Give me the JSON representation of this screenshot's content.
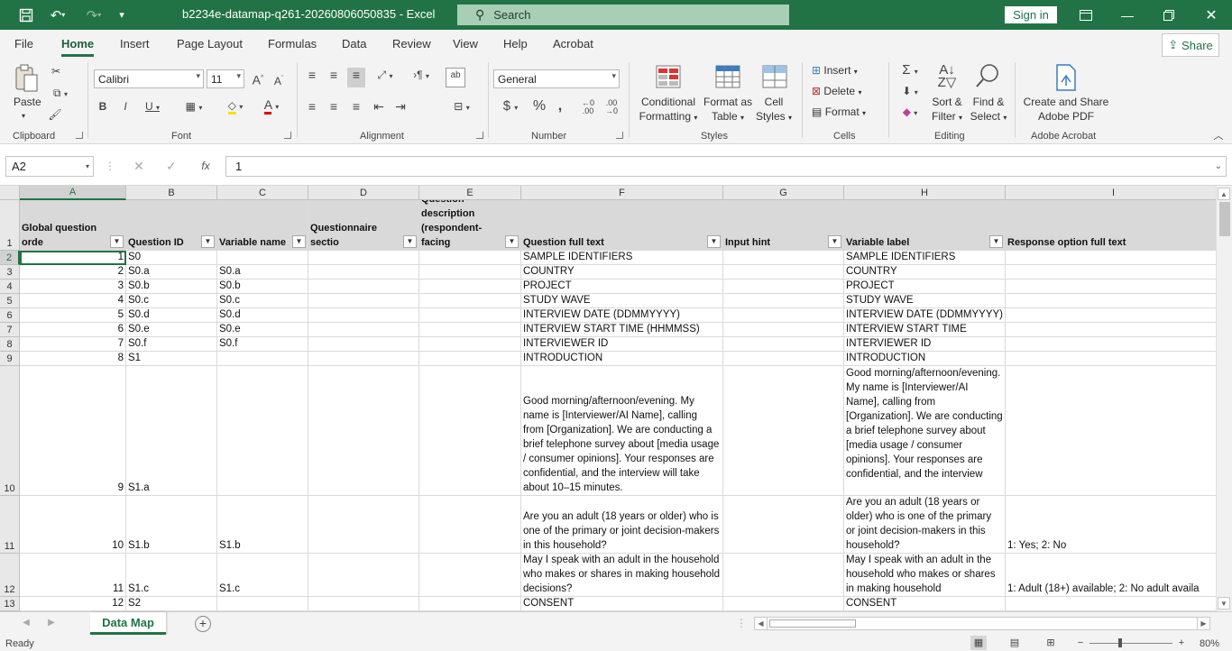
{
  "window": {
    "doc_title": "b2234e-datamap-q261-20260806050835  -  Excel",
    "search_placeholder": "Search",
    "sign_in": "Sign in"
  },
  "tabs": [
    "File",
    "Home",
    "Insert",
    "Page Layout",
    "Formulas",
    "Data",
    "Review",
    "View",
    "Help",
    "Acrobat"
  ],
  "share": "Share",
  "ribbon": {
    "clipboard": {
      "paste": "Paste",
      "label": "Clipboard"
    },
    "font": {
      "name": "Calibri",
      "size": "11",
      "label": "Font"
    },
    "alignment": {
      "label": "Alignment"
    },
    "number": {
      "format": "General",
      "label": "Number"
    },
    "styles": {
      "cond1": "Conditional",
      "cond2": "Formatting",
      "fmt1": "Format as",
      "fmt2": "Table",
      "cell1": "Cell",
      "cell2": "Styles",
      "label": "Styles"
    },
    "cells": {
      "insert": "Insert",
      "delete": "Delete",
      "format": "Format",
      "label": "Cells"
    },
    "editing": {
      "sort1": "Sort &",
      "sort2": "Filter",
      "find1": "Find &",
      "find2": "Select",
      "label": "Editing"
    },
    "acrobat": {
      "create1": "Create and Share",
      "create2": "Adobe PDF",
      "label": "Adobe Acrobat"
    }
  },
  "formula_bar": {
    "name_box": "A2",
    "fx": "fx",
    "value": "1"
  },
  "columns": [
    "A",
    "B",
    "C",
    "D",
    "E",
    "F",
    "G",
    "H",
    "I"
  ],
  "header_row": {
    "row_num": "1",
    "A": "Global question orde",
    "B": "Question ID",
    "C": "Variable name",
    "D": "Questionnaire sectio",
    "E": "Question description (respondent-facing",
    "F": "Question full text",
    "G": "Input hint",
    "H": "Variable label",
    "I": "Response option full text"
  },
  "rows": [
    {
      "n": "2",
      "A": "1",
      "B": "S0",
      "C": "",
      "F": "SAMPLE IDENTIFIERS",
      "H": "SAMPLE IDENTIFIERS",
      "I": ""
    },
    {
      "n": "3",
      "A": "2",
      "B": "S0.a",
      "C": "S0.a",
      "F": "COUNTRY",
      "H": "COUNTRY",
      "I": ""
    },
    {
      "n": "4",
      "A": "3",
      "B": "S0.b",
      "C": "S0.b",
      "F": "PROJECT",
      "H": "PROJECT",
      "I": ""
    },
    {
      "n": "5",
      "A": "4",
      "B": "S0.c",
      "C": "S0.c",
      "F": "STUDY WAVE",
      "H": "STUDY WAVE",
      "I": ""
    },
    {
      "n": "6",
      "A": "5",
      "B": "S0.d",
      "C": "S0.d",
      "F": "INTERVIEW DATE (DDMMYYYY)",
      "H": "INTERVIEW DATE (DDMMYYYY)",
      "I": ""
    },
    {
      "n": "7",
      "A": "6",
      "B": "S0.e",
      "C": "S0.e",
      "F": "INTERVIEW START TIME (HHMMSS)",
      "H": "INTERVIEW START TIME",
      "I": ""
    },
    {
      "n": "8",
      "A": "7",
      "B": "S0.f",
      "C": "S0.f",
      "F": "INTERVIEWER ID",
      "H": "INTERVIEWER ID",
      "I": ""
    },
    {
      "n": "9",
      "A": "8",
      "B": "S1",
      "C": "",
      "F": "INTRODUCTION",
      "H": "INTRODUCTION",
      "I": ""
    },
    {
      "n": "10",
      "A": "9",
      "B": "S1.a",
      "C": "",
      "F": "Good morning/afternoon/evening. My name is [Interviewer/AI Name], calling from [Organization]. We are conducting a brief telephone survey about [media usage / consumer opinions]. Your responses are confidential, and the interview will take about 10–15 minutes.",
      "H": "Good morning/afternoon/evening. My name is [Interviewer/AI Name], calling from [Organization]. We are conducting a brief telephone survey about [media usage / consumer opinions]. Your responses are confidential, and the interview",
      "I": ""
    },
    {
      "n": "11",
      "A": "10",
      "B": "S1.b",
      "C": "S1.b",
      "F": "Are you an adult (18 years or older) who is one of the primary or joint decision-makers in this household?",
      "H": "Are you an adult (18 years or older) who is one of the primary or joint decision-makers in this household?",
      "I": "1: Yes; 2: No"
    },
    {
      "n": "12",
      "A": "11",
      "B": "S1.c",
      "C": "S1.c",
      "F": "May I speak with an adult in the household who makes or shares in making household decisions?",
      "H": "May I speak with an adult in the household who makes or shares in making household",
      "I": "1: Adult (18+) available; 2: No adult availa"
    },
    {
      "n": "13",
      "A": "12",
      "B": "S2",
      "C": "",
      "F": "CONSENT",
      "H": "CONSENT",
      "I": ""
    }
  ],
  "sheet_tab": "Data Map",
  "status": {
    "ready": "Ready",
    "zoom": "80%"
  }
}
